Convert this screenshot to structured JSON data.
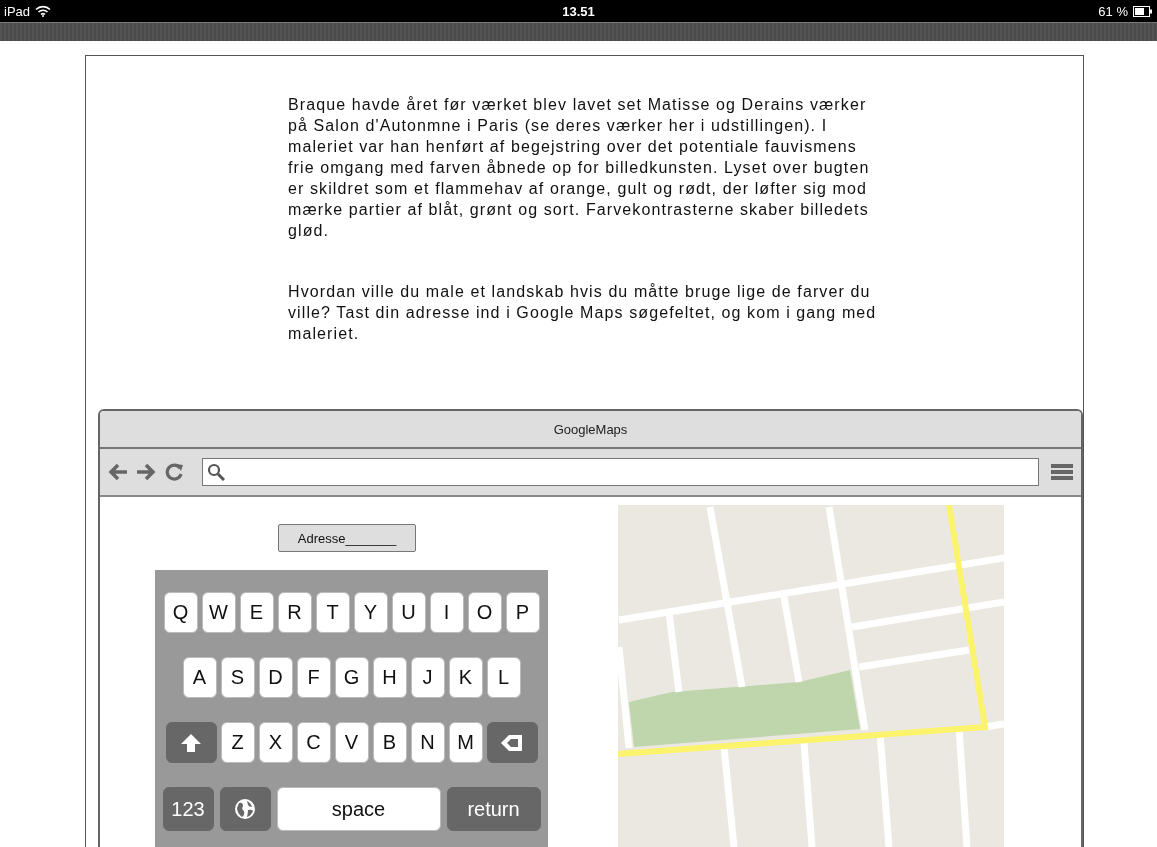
{
  "status_bar": {
    "device": "iPad",
    "time": "13.51",
    "battery": "61 %"
  },
  "article": {
    "paragraphs": [
      "Braque havde året før værket blev lavet set Matisse og Derains værker på Salon d'Autonmne i Paris (se deres værker her i udstillingen). I maleriet var han henført af begejstring over det potentiale fauvismens frie omgang med farven åbnede op for billedkunsten. Lyset over bugten er skildret som et flammehav af orange, gult og rødt, der løfter sig mod mærke partier af blåt, grønt og sort. Farvekontrasterne skaber billedets glød.",
      "Hvordan ville du male et landskab hvis du måtte bruge lige de farver du ville? Tast din adresse ind i Google Maps søgefeltet, og kom i gang med maleriet."
    ]
  },
  "browser": {
    "title": "GoogleMaps",
    "address_button": "Adresse_______",
    "keyboard": {
      "rows": [
        {
          "keys": [
            {
              "kind": "letter",
              "label": "Q"
            },
            {
              "kind": "letter",
              "label": "W"
            },
            {
              "kind": "letter",
              "label": "E"
            },
            {
              "kind": "letter",
              "label": "R"
            },
            {
              "kind": "letter",
              "label": "T"
            },
            {
              "kind": "letter",
              "label": "Y"
            },
            {
              "kind": "letter",
              "label": "U"
            },
            {
              "kind": "letter",
              "label": "I"
            },
            {
              "kind": "letter",
              "label": "O"
            },
            {
              "kind": "letter",
              "label": "P"
            }
          ]
        },
        {
          "keys": [
            {
              "kind": "letter",
              "label": "A"
            },
            {
              "kind": "letter",
              "label": "S"
            },
            {
              "kind": "letter",
              "label": "D"
            },
            {
              "kind": "letter",
              "label": "F"
            },
            {
              "kind": "letter",
              "label": "G"
            },
            {
              "kind": "letter",
              "label": "H"
            },
            {
              "kind": "letter",
              "label": "J"
            },
            {
              "kind": "letter",
              "label": "K"
            },
            {
              "kind": "letter",
              "label": "L"
            }
          ]
        },
        {
          "keys": [
            {
              "kind": "shift"
            },
            {
              "kind": "letter",
              "label": "Z"
            },
            {
              "kind": "letter",
              "label": "X"
            },
            {
              "kind": "letter",
              "label": "C"
            },
            {
              "kind": "letter",
              "label": "V"
            },
            {
              "kind": "letter",
              "label": "B"
            },
            {
              "kind": "letter",
              "label": "N"
            },
            {
              "kind": "letter",
              "label": "M"
            },
            {
              "kind": "backspace"
            }
          ]
        },
        {
          "keys": [
            {
              "kind": "numbers",
              "label": "123"
            },
            {
              "kind": "globe"
            },
            {
              "kind": "space",
              "label": "space"
            },
            {
              "kind": "return",
              "label": "return"
            }
          ]
        }
      ]
    }
  }
}
